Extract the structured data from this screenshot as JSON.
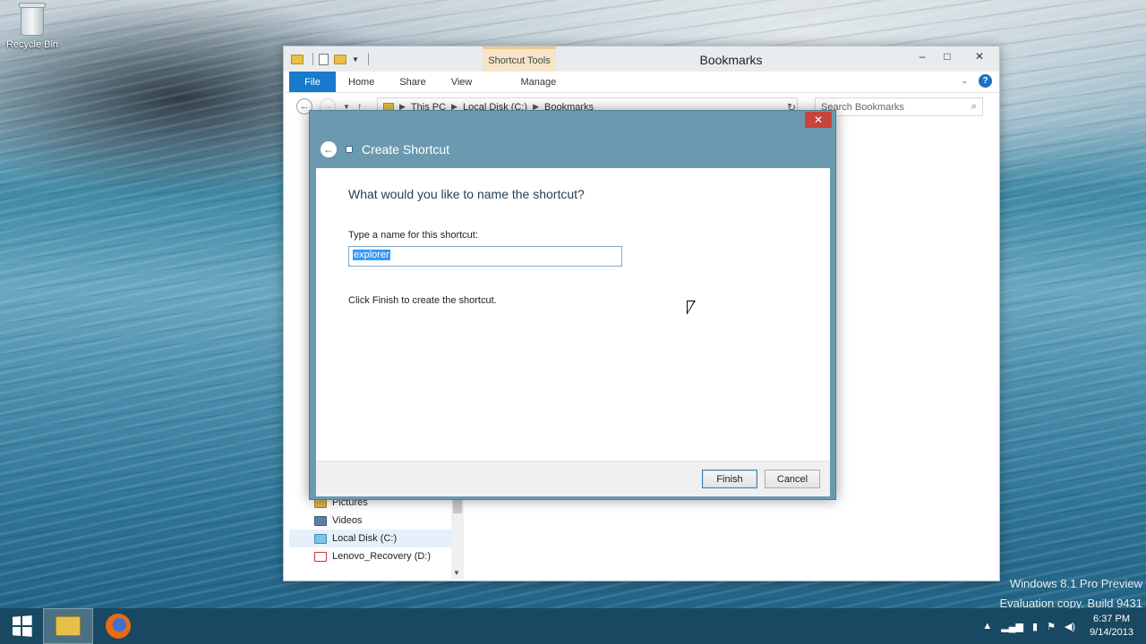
{
  "desktop": {
    "recycle_bin_label": "Recycle Bin",
    "watermark_line1": "Windows 8.1 Pro Preview",
    "watermark_line2": "Evaluation copy. Build 9431"
  },
  "explorer": {
    "title": "Bookmarks",
    "context_tab": "Shortcut Tools",
    "ribbon_tabs": [
      "File",
      "Home",
      "Share",
      "View",
      "Manage"
    ],
    "breadcrumb": [
      "This PC",
      "Local Disk (C:)",
      "Bookmarks"
    ],
    "search_placeholder": "Search Bookmarks",
    "nav_items": [
      {
        "label": "Pictures",
        "icon": "pictures-folder-icon"
      },
      {
        "label": "Videos",
        "icon": "videos-folder-icon"
      },
      {
        "label": "Local Disk (C:)",
        "icon": "local-disk-icon",
        "selected": true
      },
      {
        "label": "Lenovo_Recovery (D:)",
        "icon": "recovery-drive-icon"
      }
    ]
  },
  "dialog": {
    "title": "Create Shortcut",
    "close_glyph": "✕",
    "question": "What would you like to name the shortcut?",
    "name_label": "Type a name for this shortcut:",
    "name_value": "explorer",
    "hint": "Click Finish to create the shortcut.",
    "finish_label": "Finish",
    "cancel_label": "Cancel"
  },
  "taskbar": {
    "time": "6:37 PM",
    "date": "9/14/2013"
  },
  "colors": {
    "accent": "#1979ca",
    "dialog_frame": "#6b9ab0",
    "close_red": "#c8443b"
  }
}
